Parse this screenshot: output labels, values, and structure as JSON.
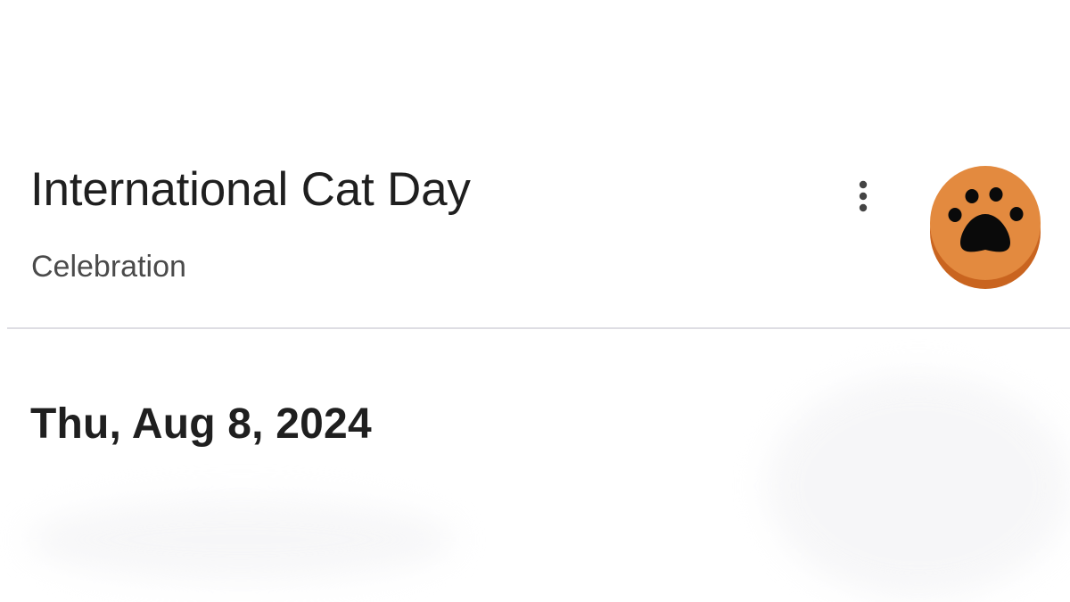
{
  "event": {
    "title": "International Cat Day",
    "category": "Celebration",
    "date": "Thu, Aug 8, 2024"
  },
  "icons": {
    "more": "more-vert-icon",
    "avatar": "paw-icon"
  },
  "colors": {
    "avatar_fill": "#E38A3F",
    "avatar_shadow": "#C9641F",
    "paw": "#0A0A0A",
    "divider": "#DEDDE3",
    "title_text": "#1F1F1F",
    "subtitle_text": "#4A4A4A"
  }
}
